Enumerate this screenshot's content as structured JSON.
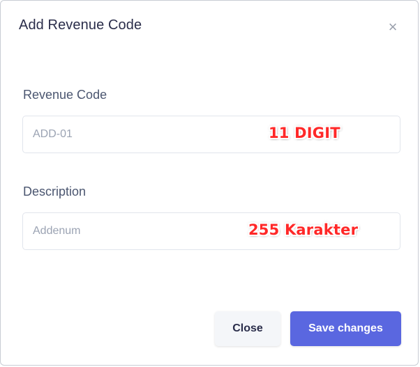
{
  "modal": {
    "title": "Add Revenue Code",
    "close_icon": "close-icon",
    "close_glyph": "×"
  },
  "fields": {
    "revenue_code": {
      "label": "Revenue Code",
      "placeholder": "ADD-01",
      "value": "",
      "annotation": "11 DIGIT"
    },
    "description": {
      "label": "Description",
      "placeholder": "Addenum",
      "value": "",
      "annotation": "255 Karakter"
    }
  },
  "footer": {
    "close_label": "Close",
    "save_label": "Save changes"
  },
  "colors": {
    "primary": "#5a67e0",
    "annotation": "#ff2828",
    "title": "#2a2d4a"
  }
}
